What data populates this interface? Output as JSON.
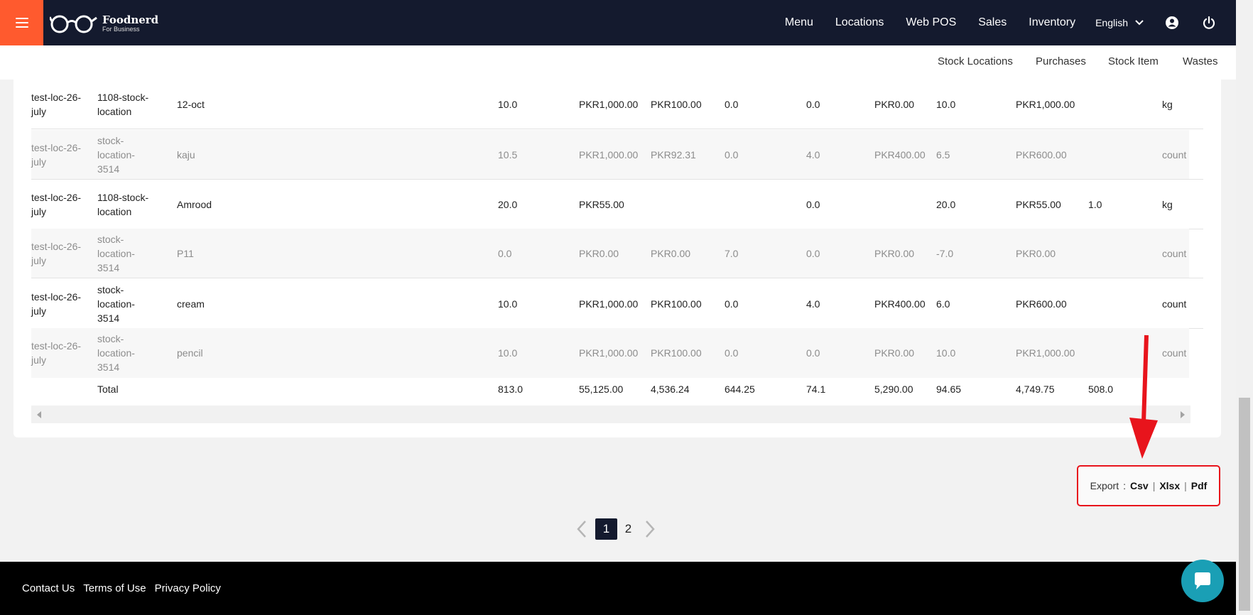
{
  "brand": {
    "name": "Foodnerd",
    "tagline": "For Business"
  },
  "topnav": {
    "items": [
      "Menu",
      "Locations",
      "Web POS",
      "Sales",
      "Inventory"
    ],
    "language": "English"
  },
  "subnav": {
    "items": [
      "Stock Locations",
      "Purchases",
      "Stock Item",
      "Wastes"
    ]
  },
  "table": {
    "rows": [
      [
        "test-loc-26-july",
        "1108-stock-location",
        "12-oct",
        "10.0",
        "PKR1,000.00",
        "PKR100.00",
        "0.0",
        "0.0",
        "PKR0.00",
        "10.0",
        "PKR1,000.00",
        "",
        "kg"
      ],
      [
        "test-loc-26-july",
        "stock-location-3514",
        "kaju",
        "10.5",
        "PKR1,000.00",
        "PKR92.31",
        "0.0",
        "4.0",
        "PKR400.00",
        "6.5",
        "PKR600.00",
        "",
        "count"
      ],
      [
        "test-loc-26-july",
        "1108-stock-location",
        "Amrood",
        "20.0",
        "PKR55.00",
        "",
        "",
        "0.0",
        "",
        "20.0",
        "PKR55.00",
        "1.0",
        "kg"
      ],
      [
        "test-loc-26-july",
        "stock-location-3514",
        "P11",
        "0.0",
        "PKR0.00",
        "PKR0.00",
        "7.0",
        "0.0",
        "PKR0.00",
        "-7.0",
        "PKR0.00",
        "",
        "count"
      ],
      [
        "test-loc-26-july",
        "stock-location-3514",
        "cream",
        "10.0",
        "PKR1,000.00",
        "PKR100.00",
        "0.0",
        "4.0",
        "PKR400.00",
        "6.0",
        "PKR600.00",
        "",
        "count"
      ],
      [
        "test-loc-26-july",
        "stock-location-3514",
        "pencil",
        "10.0",
        "PKR1,000.00",
        "PKR100.00",
        "0.0",
        "0.0",
        "PKR0.00",
        "10.0",
        "PKR1,000.00",
        "",
        "count"
      ]
    ],
    "total": {
      "label": "Total",
      "values": [
        "813.0",
        "55,125.00",
        "4,536.24",
        "644.25",
        "74.1",
        "5,290.00",
        "94.65",
        "4,749.75",
        "508.0"
      ]
    }
  },
  "export": {
    "label": "Export",
    "colon": ":",
    "sep": "|",
    "csv": "Csv",
    "xlsx": "Xlsx",
    "pdf": "Pdf"
  },
  "pagination": {
    "pages": [
      "1",
      "2"
    ],
    "current": "1"
  },
  "footer": {
    "links": [
      "Contact Us",
      "Terms of Use",
      "Privacy Policy"
    ]
  },
  "colors": {
    "nav_bg": "#141a2e",
    "accent": "#ff5a2e",
    "highlight": "#e8141c",
    "chat": "#1a9fb5"
  }
}
